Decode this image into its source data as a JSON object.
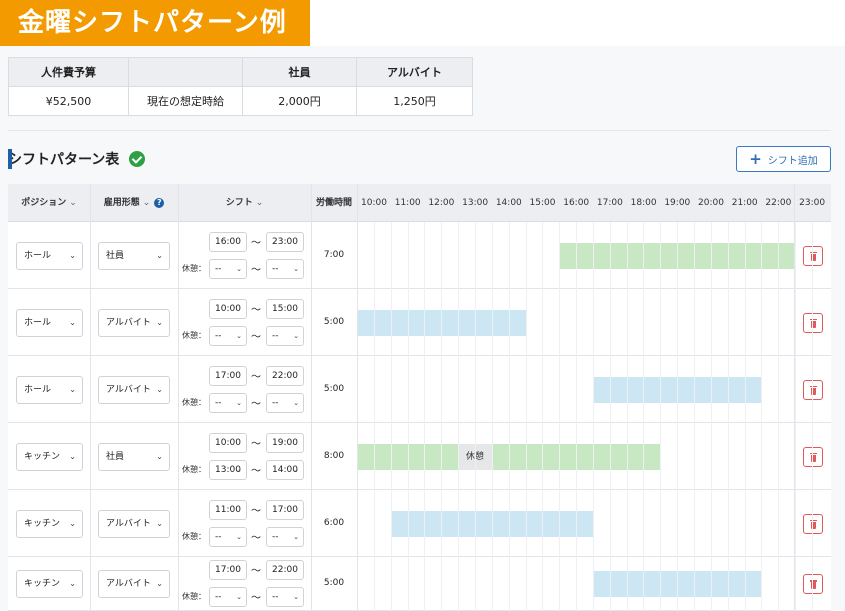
{
  "page_title": "金曜シフトパターン例",
  "budget": {
    "headers": [
      "人件費予算",
      "",
      "社員",
      "アルバイト"
    ],
    "values": [
      "¥52,500",
      "現在の想定時給",
      "2,000円",
      "1,250円"
    ]
  },
  "section": {
    "title": "シフトパターン表",
    "add_button": "シフト追加"
  },
  "columns": {
    "position": "ポジション",
    "employment": "雇用形態",
    "shift": "シフト",
    "work_hours": "労働時間",
    "help_mark": "?"
  },
  "hours": [
    "10:00",
    "11:00",
    "12:00",
    "13:00",
    "14:00",
    "15:00",
    "16:00",
    "17:00",
    "18:00",
    "19:00",
    "20:00",
    "21:00",
    "22:00",
    "23:00"
  ],
  "break_label": "休憩：",
  "break_chip": "休憩",
  "tilde": "〜",
  "colors": {
    "accent": "#f29a00",
    "full_time_bar": "#c8e8c4",
    "part_time_bar": "#cde6f3",
    "delete": "#e0585a"
  },
  "rows": [
    {
      "position": "ホール",
      "employment": "社員",
      "start": "16:00",
      "end": "23:00",
      "break_start": "--",
      "break_end": "--",
      "hours": "7:00",
      "kind": "full",
      "bar_start": 16.0,
      "bar_end": 23.0
    },
    {
      "position": "ホール",
      "employment": "アルバイト",
      "start": "10:00",
      "end": "15:00",
      "break_start": "--",
      "break_end": "--",
      "hours": "5:00",
      "kind": "part",
      "bar_start": 10.0,
      "bar_end": 15.0
    },
    {
      "position": "ホール",
      "employment": "アルバイト",
      "start": "17:00",
      "end": "22:00",
      "break_start": "--",
      "break_end": "--",
      "hours": "5:00",
      "kind": "part",
      "bar_start": 17.0,
      "bar_end": 22.0
    },
    {
      "position": "キッチン",
      "employment": "社員",
      "start": "10:00",
      "end": "19:00",
      "break_start": "13:00",
      "break_end": "14:00",
      "hours": "8:00",
      "kind": "full",
      "bar_start": 10.0,
      "bar_end": 19.0,
      "brk_start": 13.0,
      "brk_end": 14.0
    },
    {
      "position": "キッチン",
      "employment": "アルバイト",
      "start": "11:00",
      "end": "17:00",
      "break_start": "--",
      "break_end": "--",
      "hours": "6:00",
      "kind": "part",
      "bar_start": 11.0,
      "bar_end": 17.0
    },
    {
      "position": "キッチン",
      "employment": "アルバイト",
      "start": "17:00",
      "end": "22:00",
      "break_start": "--",
      "break_end": "--",
      "hours": "5:00",
      "kind": "part",
      "bar_start": 17.0,
      "bar_end": 22.0
    }
  ]
}
